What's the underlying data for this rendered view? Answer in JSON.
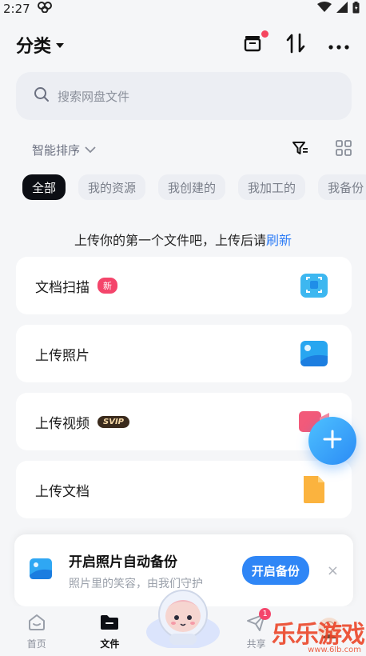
{
  "status_bar": {
    "time": "2:27"
  },
  "header": {
    "title": "分类"
  },
  "search": {
    "placeholder": "搜索网盘文件"
  },
  "sort": {
    "label": "智能排序"
  },
  "chips": [
    "全部",
    "我的资源",
    "我创建的",
    "我加工的",
    "我备份"
  ],
  "prompt": {
    "text": "上传你的第一个文件吧，上传后请",
    "link": "刷新"
  },
  "cards": [
    {
      "label": "文档扫描",
      "badge": "新"
    },
    {
      "label": "上传照片"
    },
    {
      "label": "上传视频",
      "badge": "SVIP"
    },
    {
      "label": "上传文档"
    }
  ],
  "backup": {
    "title": "开启照片自动备份",
    "subtitle": "照片里的笑容，由我们守护",
    "button": "开启备份",
    "close": "×"
  },
  "tabs": [
    {
      "label": "首页"
    },
    {
      "label": "文件"
    },
    {
      "label": ""
    },
    {
      "label": "共享",
      "badge": "1"
    },
    {
      "label": ""
    }
  ],
  "watermark": {
    "text": "乐乐游戏",
    "url": "www.6lb.com"
  },
  "colors": {
    "accent": "#2f86f6",
    "chip_active": "#0c0e14",
    "badge_red": "#f4456b"
  }
}
